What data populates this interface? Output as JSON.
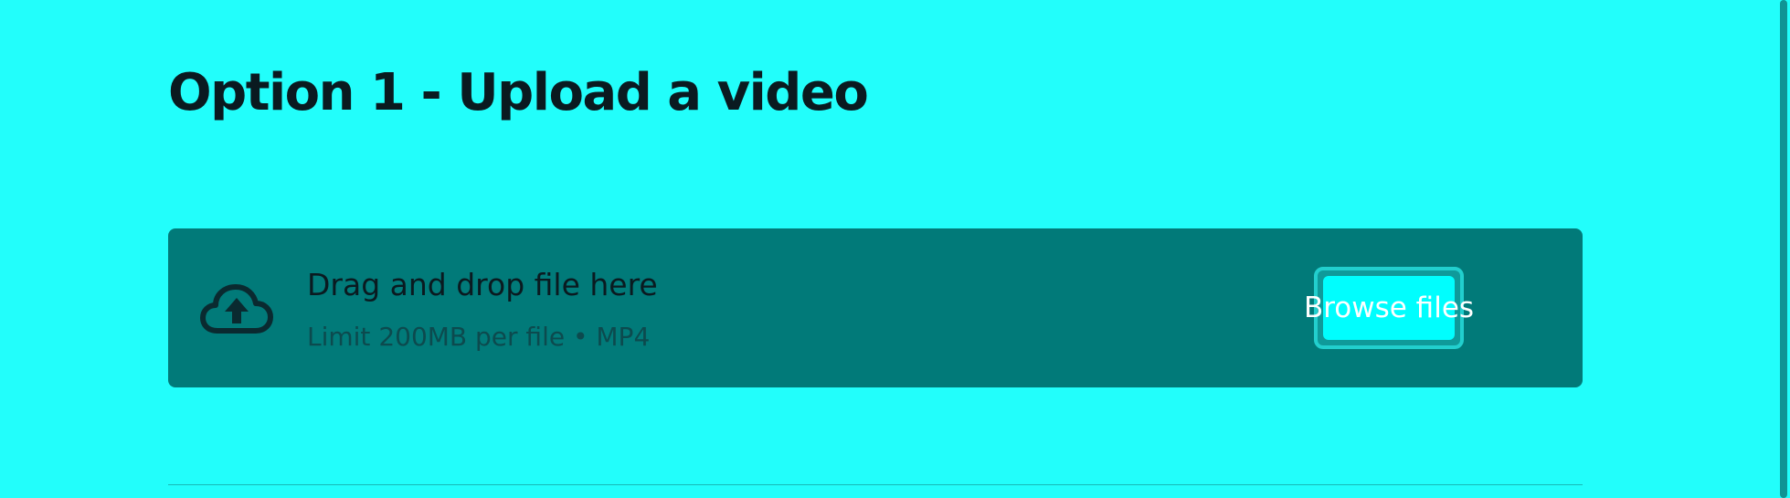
{
  "page": {
    "title": "Option 1 - Upload a video",
    "background_color": "#22FEFB"
  },
  "uploader": {
    "title": "Drag and drop file here",
    "subtitle": "Limit 200MB per file • MP4",
    "browse_label": "Browse files",
    "icon": "cloud-upload-icon",
    "dropzone_color": "#017A79",
    "button_color": "#00FEFE"
  }
}
